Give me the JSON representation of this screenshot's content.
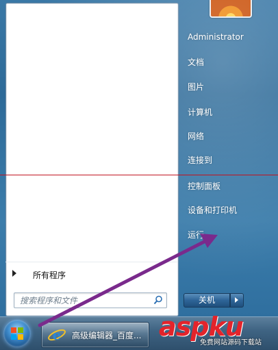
{
  "left_pane": {
    "all_programs_label": "所有程序",
    "search_placeholder": "搜索程序和文件"
  },
  "right_column": {
    "user_name": "Administrator",
    "items": [
      {
        "label": "文档"
      },
      {
        "label": "图片"
      },
      {
        "label": "计算机"
      },
      {
        "label": "网络"
      },
      {
        "label": "连接到"
      },
      {
        "label": "控制面板"
      },
      {
        "label": "设备和打印机"
      },
      {
        "label": "运行..."
      }
    ]
  },
  "shutdown": {
    "label": "关机"
  },
  "taskbar": {
    "task_label": "高级编辑器_百度..."
  },
  "watermark": {
    "brand": "aspku",
    "tagline": "免费网站源码下载站"
  },
  "icons": {
    "search": "search-icon",
    "start_orb": "windows-start-icon",
    "browser": "internet-explorer-icon",
    "user": "user-picture-icon"
  },
  "colors": {
    "annotation_arrow": "#7a2a8c",
    "separator": "#c0121f"
  }
}
